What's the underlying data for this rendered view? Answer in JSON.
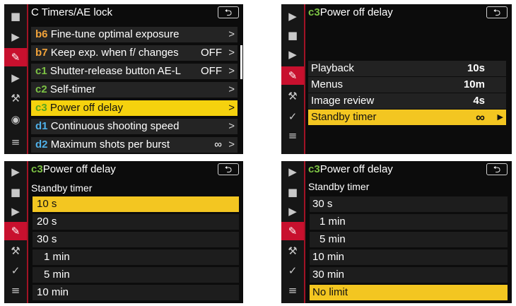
{
  "icons": {
    "camera": "■",
    "video": "▶",
    "pencil": "✎",
    "playback": "▶",
    "wrench": "⚒",
    "retouch": "✓",
    "mymenu": "≡",
    "network": "◉"
  },
  "panel1": {
    "title": "C  Timers/AE lock",
    "back": "⮌",
    "items": [
      {
        "code": "b6",
        "label": "Fine-tune optimal exposure",
        "value": "",
        "arrow": ">"
      },
      {
        "code": "b7",
        "label": "Keep exp. when f/ changes",
        "value": "OFF",
        "arrow": ">"
      },
      {
        "code": "c1",
        "label": "Shutter-release button AE-L",
        "value": "OFF",
        "arrow": ">"
      },
      {
        "code": "c2",
        "label": "Self-timer",
        "value": "",
        "arrow": ">"
      },
      {
        "code": "c3",
        "label": "Power off delay",
        "value": "",
        "arrow": ">"
      },
      {
        "code": "d1",
        "label": "Continuous shooting speed",
        "value": "",
        "arrow": ">"
      },
      {
        "code": "d2",
        "label": "Maximum shots per burst",
        "value": "∞",
        "arrow": ">"
      }
    ]
  },
  "panel2": {
    "code": "c3",
    "title": "Power off delay",
    "back": "⮌",
    "items": [
      {
        "label": "Playback",
        "value": "10s"
      },
      {
        "label": "Menus",
        "value": "10m"
      },
      {
        "label": "Image review",
        "value": "4s"
      },
      {
        "label": "Standby timer",
        "value": "∞",
        "arrow": "▶"
      }
    ]
  },
  "panel3": {
    "code": "c3",
    "title": "Power off delay",
    "back": "⮌",
    "subtitle": "Standby timer",
    "options": [
      "10 s",
      "20 s",
      "30 s",
      "1 min",
      "5 min",
      "10 min"
    ]
  },
  "panel4": {
    "code": "c3",
    "title": "Power off delay",
    "back": "⮌",
    "subtitle": "Standby timer",
    "options": [
      "30 s",
      "1 min",
      "5 min",
      "10 min",
      "30 min",
      "No limit"
    ]
  }
}
